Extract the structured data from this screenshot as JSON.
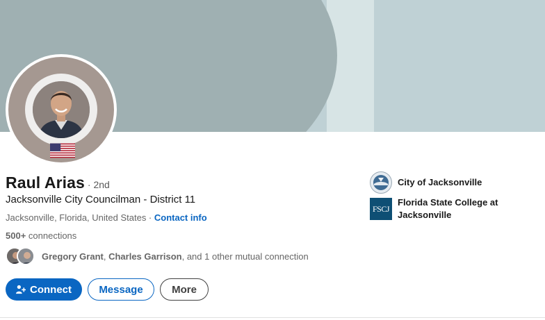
{
  "profile": {
    "name": "Raul Arias",
    "degree": "· 2nd",
    "headline": "Jacksonville City Councilman - District 11",
    "location": "Jacksonville, Florida, United States",
    "separator": " · ",
    "contact_info": "Contact info",
    "connections_count": "500+",
    "connections_label": " connections"
  },
  "mutual": {
    "name1": "Gregory Grant",
    "comma": ", ",
    "name2": "Charles Garrison",
    "suffix": ", and 1 other mutual connection"
  },
  "actions": {
    "connect": "Connect",
    "message": "Message",
    "more": "More"
  },
  "organizations": [
    {
      "name": "City of Jacksonville",
      "icon": "city-seal-icon"
    },
    {
      "name": "Florida State College at Jacksonville",
      "logo_text": "FSCJ",
      "icon": "fscj-logo"
    }
  ],
  "colors": {
    "primary": "#0a66c2",
    "text": "#191919",
    "muted": "#666666",
    "cover_dark": "#9fb0b2",
    "cover_light": "#bfd1d5"
  }
}
